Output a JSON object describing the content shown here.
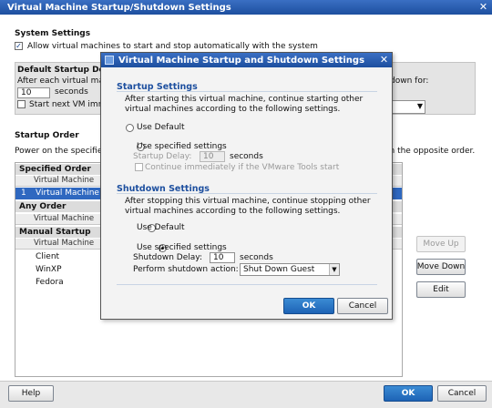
{
  "window": {
    "title": "Virtual Machine Startup/Shutdown Settings",
    "close_label": "✕",
    "system_settings_heading": "System Settings",
    "allow_auto_label": "Allow virtual machines to start and stop automatically with the system",
    "default_startup_heading": "Default Startup Del",
    "after_each_vm": "After each virtual mac",
    "shutdown_for": "down for:",
    "delay_value": "10",
    "seconds_label": "seconds",
    "start_next_label": "Start next VM imm",
    "startup_order_heading": "Startup Order",
    "power_on_text": "Power on the specified",
    "opposite_order": "in the opposite order.",
    "groups": {
      "specified": {
        "heading": "Specified Order",
        "column": "Virtual Machine",
        "rows": [
          {
            "index": "1",
            "name": "Virtual Machine"
          }
        ]
      },
      "any": {
        "heading": "Any Order",
        "column": "Virtual Machine"
      },
      "manual": {
        "heading": "Manual Startup",
        "column": "Virtual Machine",
        "rows": [
          "Client",
          "WinXP",
          "Fedora"
        ]
      }
    },
    "move_up_label": "Move Up",
    "move_down_label": "Move Down",
    "edit_label": "Edit",
    "help_label": "Help",
    "ok_label": "OK",
    "cancel_label": "Cancel"
  },
  "dialog": {
    "title": "Virtual Machine Startup and Shutdown Settings",
    "close_label": "✕",
    "startup": {
      "heading": "Startup Settings",
      "description": "After starting this virtual machine, continue starting other virtual machines according to the following settings.",
      "use_default_label": "Use Default",
      "use_specified_label": "Use specified settings",
      "delay_label": "Startup Delay:",
      "delay_value": "10",
      "seconds_label": "seconds",
      "continue_label": "Continue immediately if the VMware Tools start"
    },
    "shutdown": {
      "heading": "Shutdown Settings",
      "description": "After stopping this virtual machine, continue stopping other virtual machines according to the following settings.",
      "use_default_label": "Use Default",
      "use_specified_label": "Use specified settings",
      "delay_label": "Shutdown Delay:",
      "delay_value": "10",
      "seconds_label": "seconds",
      "action_label": "Perform shutdown action:",
      "action_value": "Shut Down Guest"
    },
    "ok_label": "OK",
    "cancel_label": "Cancel"
  },
  "colors": {
    "title_bar": "#1d4f9f",
    "primary_button": "#1d63b5",
    "selection": "#2f68c0",
    "section_heading": "#1d4f9f"
  }
}
